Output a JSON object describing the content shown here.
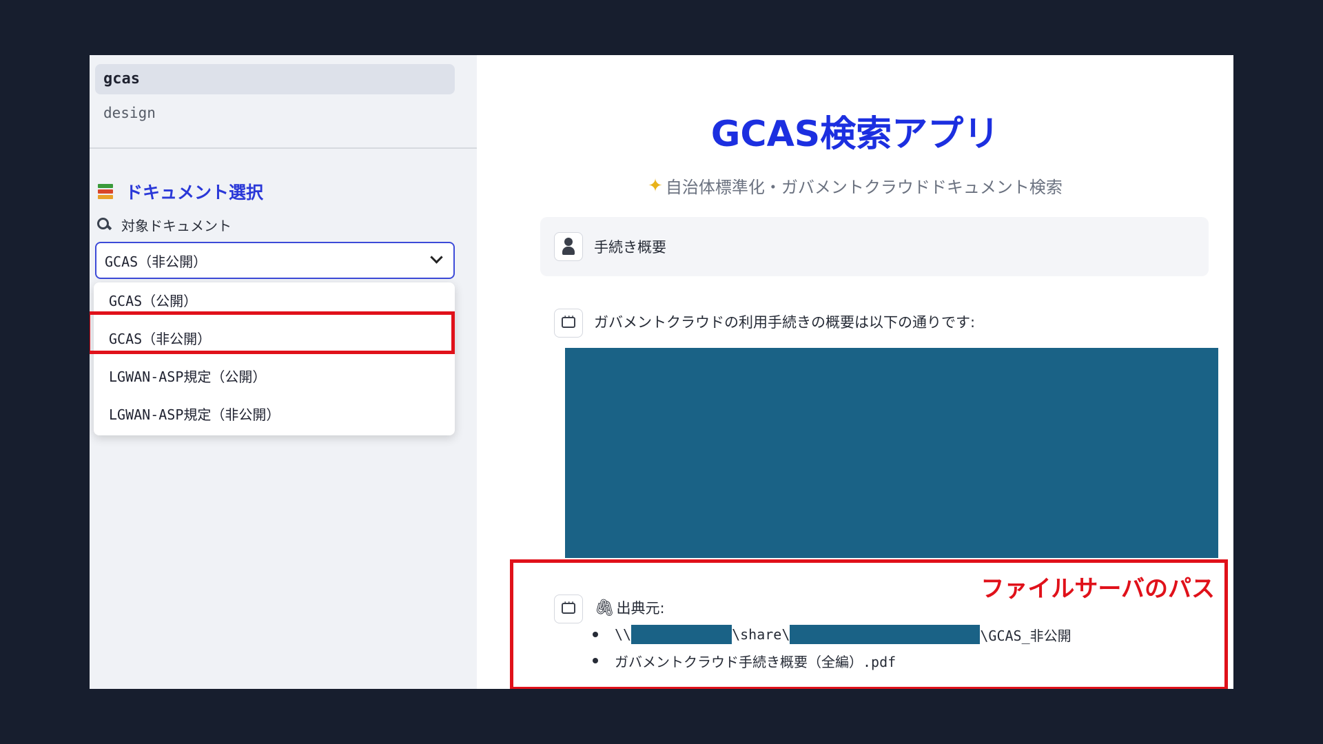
{
  "sidebar": {
    "nav": [
      {
        "label": "gcas",
        "active": true
      },
      {
        "label": "design",
        "active": false
      }
    ],
    "section_title": "ドキュメント選択",
    "field_label": "対象ドキュメント",
    "select": {
      "value": "GCAS（非公開）",
      "options": [
        "GCAS（公開）",
        "GCAS（非公開）",
        "LGWAN-ASP規定（公開）",
        "LGWAN-ASP規定（非公開）"
      ]
    }
  },
  "main": {
    "title": "GCAS検索アプリ",
    "subtitle": "自治体標準化・ガバメントクラウドドキュメント検索",
    "user_message": "手続き概要",
    "assistant_message": "ガバメントクラウドの利用手続きの概要は以下の通りです:",
    "source": {
      "label": "出典元:",
      "path_prefix": "\\\\",
      "path_middle": "\\share\\",
      "path_suffix": "\\GCAS_非公開",
      "file": "ガバメントクラウド手続き概要（全編）.pdf"
    },
    "annotation": "ファイルサーバのパス"
  },
  "colors": {
    "accent": "#1c2fe0",
    "highlight_red": "#e0111a",
    "redaction": "#1a6286",
    "background": "#171e2e"
  },
  "icons": {
    "section": "books-icon",
    "field": "magnifier-icon",
    "user": "user-avatar-icon",
    "assistant": "chat-icon",
    "subtitle": "sparkle-icon",
    "source": "paperclip-icon"
  }
}
